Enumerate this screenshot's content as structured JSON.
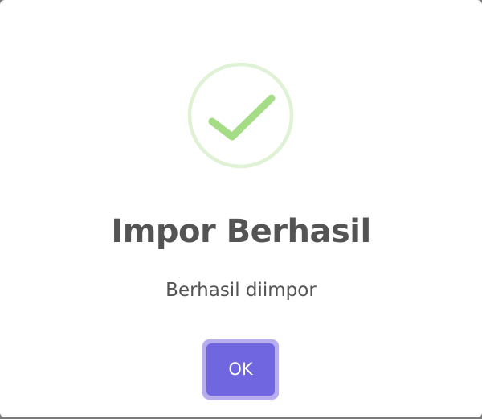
{
  "dialog": {
    "icon": "success-check-icon",
    "title": "Impor Berhasil",
    "message": "Berhasil diimpor",
    "confirm_label": "OK"
  },
  "colors": {
    "success_ring": "#dff2d6",
    "success_check": "#a5dc86",
    "title_text": "#545454",
    "confirm_bg": "#7066e0",
    "confirm_focus_ring": "#b7aeef",
    "overlay": "#7a7a7a"
  }
}
